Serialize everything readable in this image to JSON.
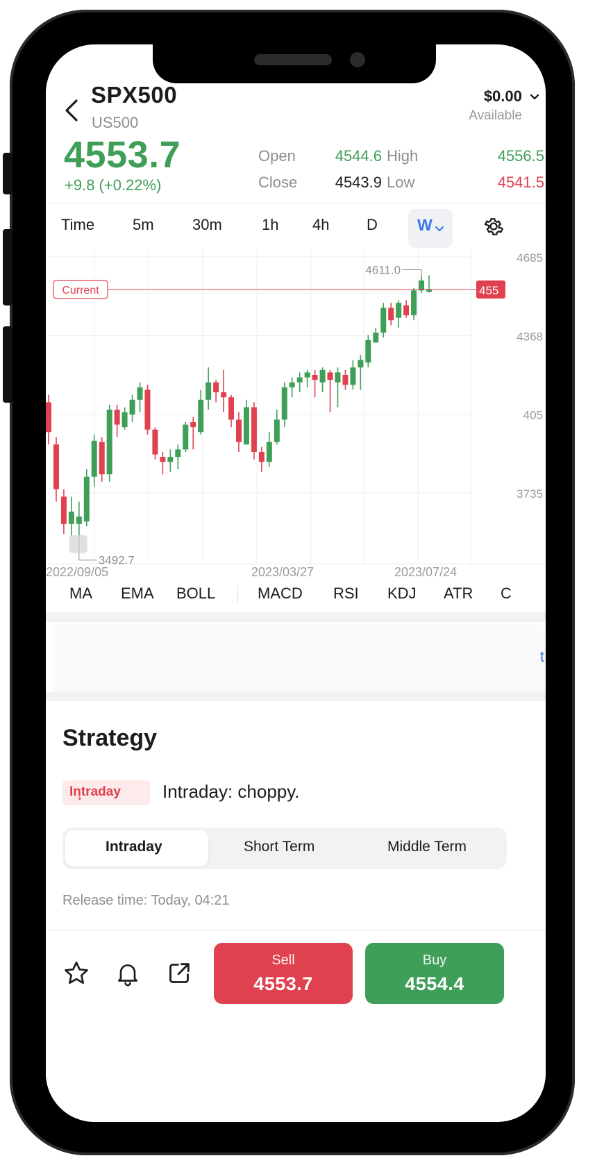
{
  "header": {
    "symbol": "SPX500",
    "symbol_sub": "US500",
    "balance": "$0.00",
    "balance_label": "Available"
  },
  "quote": {
    "price": "4553.7",
    "change": "+9.8 (+0.22%)",
    "open_label": "Open",
    "open": "4544.6",
    "high_label": "High",
    "high": "4556.5",
    "close_label": "Close",
    "close": "4543.9",
    "low_label": "Low",
    "low": "4541.5"
  },
  "timeframes": [
    "Time",
    "5m",
    "30m",
    "1h",
    "4h",
    "D"
  ],
  "timeframe_active": "W",
  "chart_data": {
    "type": "candlestick",
    "current_label": "Current",
    "current_price_tag": "455",
    "current_value": 4553.7,
    "max_label": "4611.0",
    "max_value": 4611.0,
    "min_label": "3492.7",
    "min_value": 3492.7,
    "y_tick_labels": [
      "4685",
      "4368",
      "405",
      "3735"
    ],
    "y_ticks": [
      4685,
      4368,
      4052,
      3735
    ],
    "x_tick_labels": [
      "2022/09/05",
      "2023/03/27",
      "2023/07/24"
    ],
    "candles": [
      [
        4100,
        3980,
        4130,
        3930
      ],
      [
        3930,
        3750,
        3960,
        3700
      ],
      [
        3720,
        3610,
        3750,
        3570
      ],
      [
        3610,
        3660,
        3720,
        3560
      ],
      [
        3610,
        3640,
        3700,
        3492.7
      ],
      [
        3620,
        3800,
        3830,
        3600
      ],
      [
        3800,
        3945,
        3970,
        3760
      ],
      [
        3940,
        3810,
        3960,
        3780
      ],
      [
        3810,
        4070,
        4090,
        3780
      ],
      [
        4070,
        4010,
        4090,
        3960
      ],
      [
        4000,
        4060,
        4080,
        3990
      ],
      [
        4050,
        4110,
        4130,
        4020
      ],
      [
        4110,
        4160,
        4180,
        4060
      ],
      [
        4150,
        3990,
        4170,
        3970
      ],
      [
        3990,
        3890,
        4000,
        3870
      ],
      [
        3880,
        3860,
        3900,
        3810
      ],
      [
        3860,
        3880,
        3910,
        3820
      ],
      [
        3880,
        3910,
        3930,
        3830
      ],
      [
        3910,
        4010,
        4020,
        3900
      ],
      [
        4020,
        4000,
        4040,
        3910
      ],
      [
        3980,
        4110,
        4150,
        3970
      ],
      [
        4110,
        4180,
        4240,
        4070
      ],
      [
        4180,
        4140,
        4190,
        4100
      ],
      [
        4140,
        4120,
        4230,
        4060
      ],
      [
        4120,
        4030,
        4130,
        4000
      ],
      [
        4030,
        3940,
        4060,
        3900
      ],
      [
        3930,
        4080,
        4110,
        3930
      ],
      [
        4080,
        3900,
        4100,
        3870
      ],
      [
        3900,
        3860,
        3920,
        3820
      ],
      [
        3860,
        3940,
        3980,
        3840
      ],
      [
        3940,
        4030,
        4070,
        3930
      ],
      [
        4030,
        4160,
        4180,
        4000
      ],
      [
        4160,
        4180,
        4200,
        4120
      ],
      [
        4180,
        4200,
        4220,
        4140
      ],
      [
        4200,
        4220,
        4230,
        4160
      ],
      [
        4210,
        4190,
        4230,
        4120
      ],
      [
        4180,
        4230,
        4240,
        4140
      ],
      [
        4220,
        4190,
        4230,
        4060
      ],
      [
        4180,
        4220,
        4240,
        4080
      ],
      [
        4210,
        4170,
        4230,
        4150
      ],
      [
        4170,
        4240,
        4270,
        4150
      ],
      [
        4240,
        4270,
        4290,
        4150
      ],
      [
        4260,
        4350,
        4370,
        4240
      ],
      [
        4340,
        4380,
        4400,
        4340
      ],
      [
        4380,
        4480,
        4500,
        4360
      ],
      [
        4480,
        4430,
        4500,
        4410
      ],
      [
        4440,
        4500,
        4510,
        4400
      ],
      [
        4490,
        4450,
        4510,
        4440
      ],
      [
        4450,
        4550,
        4560,
        4430
      ],
      [
        4550,
        4590,
        4611.0,
        4540
      ],
      [
        4544.6,
        4553.7,
        4611.0,
        4541.5
      ]
    ]
  },
  "indicators": [
    "MA",
    "EMA",
    "BOLL",
    "MACD",
    "RSI",
    "KDJ",
    "ATR"
  ],
  "blank_card_link": "t",
  "strategy": {
    "title": "Strategy",
    "badge": "Intraday",
    "summary": "Intraday: choppy.",
    "tabs": [
      "Intraday",
      "Short Term",
      "Middle Term"
    ],
    "release": "Release time: Today, 04:21"
  },
  "trade": {
    "sell_label": "Sell",
    "sell_price": "4553.7",
    "buy_label": "Buy",
    "buy_price": "4554.4"
  },
  "colors": {
    "up": "#3f9e57",
    "down": "#e0414e",
    "accent": "#3a78e8"
  }
}
